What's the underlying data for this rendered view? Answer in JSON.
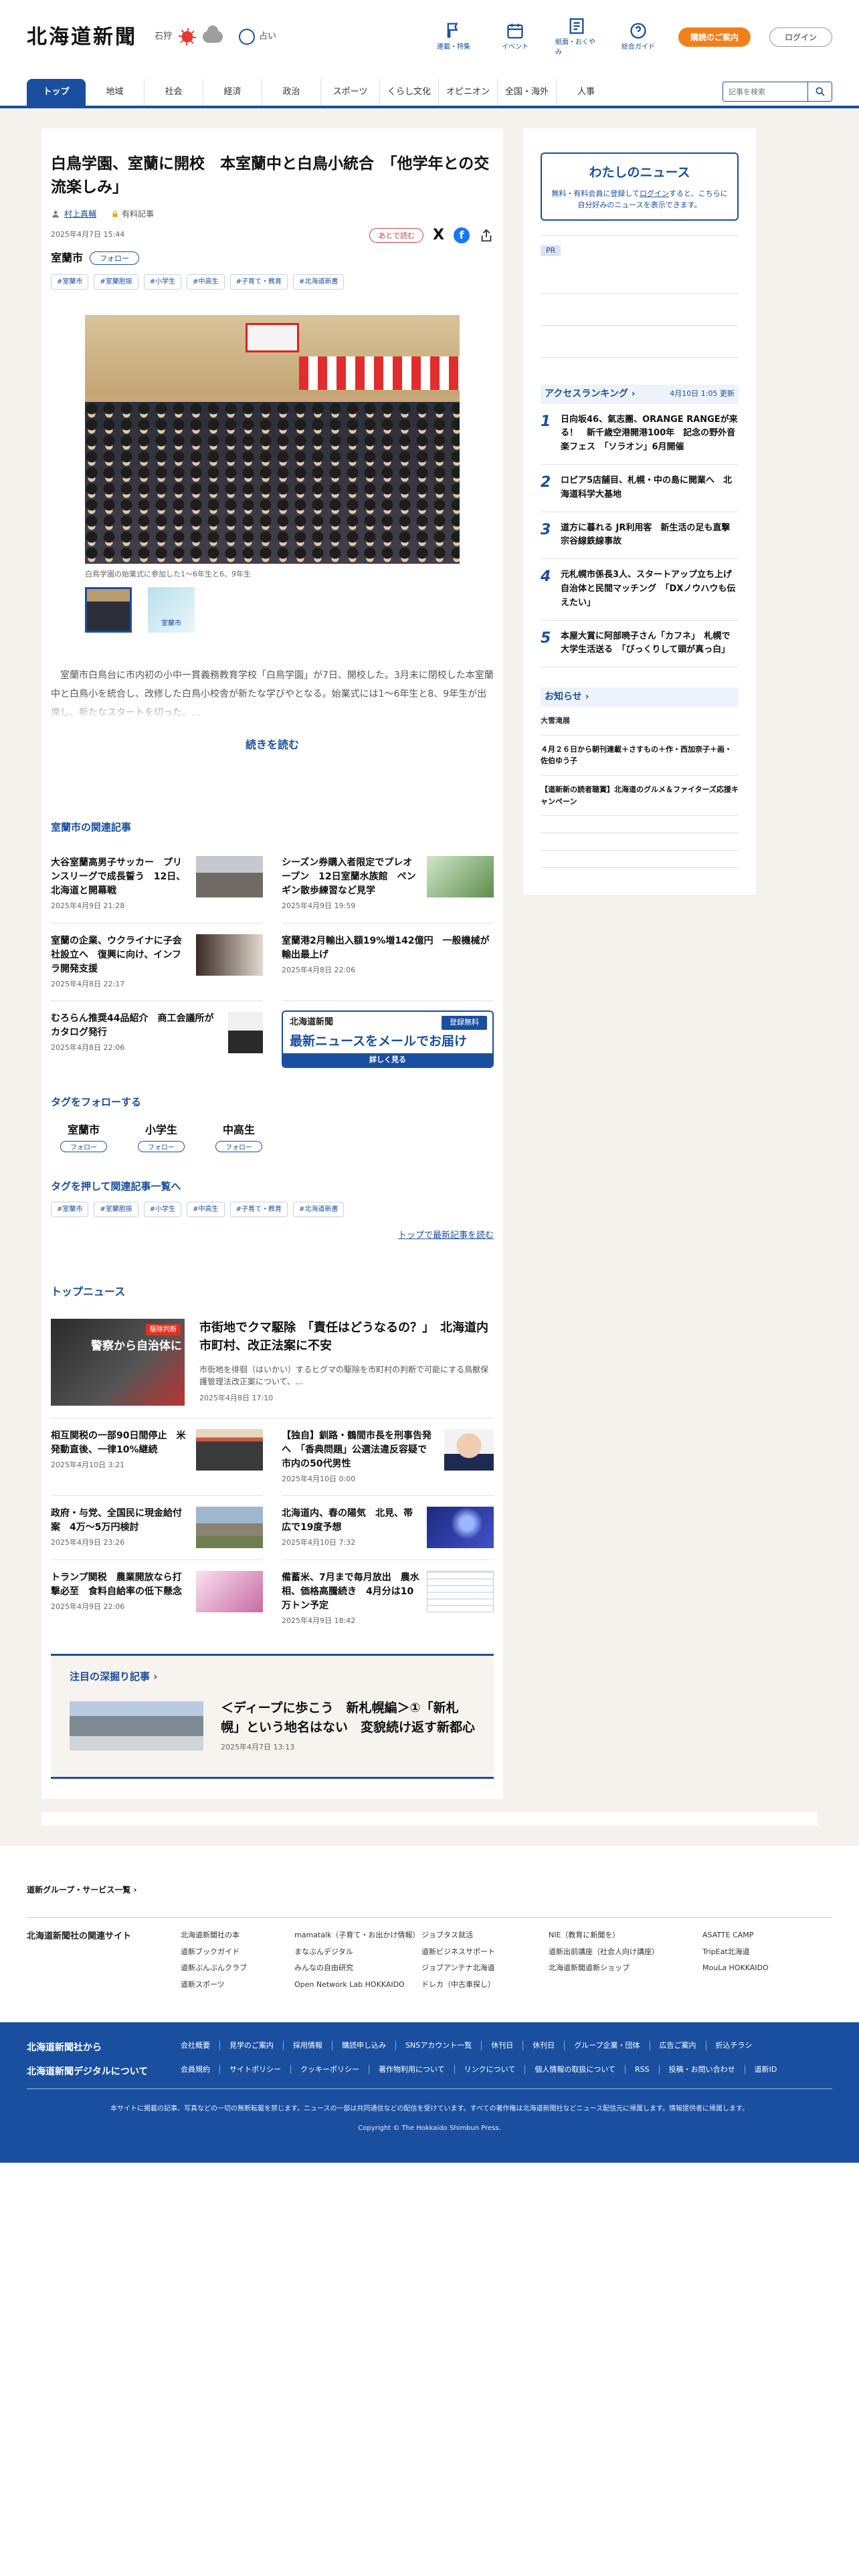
{
  "header": {
    "logo": "北海道新聞",
    "weather_location": "石狩",
    "fortune_label": "占い",
    "icon_links": [
      "連載・特集",
      "イベント",
      "紙面・おくやみ",
      "総合ガイド"
    ],
    "subscribe_label": "購読のご案内",
    "login_label": "ログイン"
  },
  "nav": {
    "items": [
      "トップ",
      "地域",
      "社会",
      "経済",
      "政治",
      "スポーツ",
      "くらし文化",
      "オピニオン",
      "全国・海外",
      "人事"
    ],
    "search_placeholder": "記事を検索"
  },
  "article": {
    "title": "白鳥学園、室蘭に開校　本室蘭中と白鳥小統合　「他学年との交流楽しみ」",
    "author": "村上真輔",
    "paid_label": "有料記事",
    "date": "2025年4月7日 15:44",
    "read_later": "あとで読む",
    "city": "室蘭市",
    "follow_label": "フォロー",
    "tags": [
      "#室蘭市",
      "#室蘭胆振",
      "#小学生",
      "#中高生",
      "#子育て・教育",
      "#北海道新書"
    ],
    "photo_caption": "白鳥学園の始業式に参加した1〜6年生と6、9年生",
    "thumb2_label": "室蘭市",
    "lead": "室蘭市白鳥台に市内初の小中一貫義務教育学校「白鳥学園」が7日、開校した。3月末に閉校した本室蘭中と白鳥小を統合し、改修した白鳥小校舎が新たな学びやとなる。始業式には1〜6年生と8、9年生が出席し、新たなスタートを切った。…",
    "read_more": "続きを読む"
  },
  "related": {
    "title": "室蘭市の関連記事",
    "items": [
      {
        "title": "大谷室蘭高男子サッカー　プリンスリーグで成長誓う　12日、北海道と開幕戦",
        "date": "2025年4月9日 21:28"
      },
      {
        "title": "シーズン券購入者限定でプレオープン　12日室蘭水族館　ペンギン散歩練習など見学",
        "date": "2025年4月9日 19:59"
      },
      {
        "title": "室蘭の企業、ウクライナに子会社設立へ　復興に向け、インフラ開発支援",
        "date": "2025年4月8日 22:17"
      },
      {
        "title": "室蘭港2月輸出入額19%増142億円　一般機械が輸出最上げ",
        "date": "2025年4月8日 22:06"
      },
      {
        "title": "むろらん推奨44品紹介　商工会議所がカタログ発行",
        "date": "2025年4月8日 22:06"
      }
    ],
    "mail_logo": "北海道新聞",
    "mail_free": "登録無料",
    "mail_head": "最新ニュースをメールでお届け",
    "mail_foot": "詳しく見る"
  },
  "follow_tags": {
    "title": "タグをフォローする",
    "items": [
      "室蘭市",
      "小学生",
      "中高生"
    ],
    "button": "フォロー"
  },
  "tag_press": {
    "title": "タグを押して関連記事一覧へ",
    "tags": [
      "#室蘭市",
      "#室蘭胆振",
      "#小学生",
      "#中高生",
      "#子育て・教育",
      "#北海道新書"
    ],
    "more": "トップで最新記事を読む"
  },
  "top_news": {
    "title": "トップニュース",
    "lead": {
      "title": "市街地でクマ駆除　「責任はどうなるの？」　北海道内市町村、改正法案に不安",
      "summary": "市街地を徘徊（はいかい）するヒグマの駆除を市町村の判断で可能にする鳥獣保護管理法改正案について、…",
      "date": "2025年4月8日 17:10",
      "img_tag": "駆除判断",
      "img_label": "警察から自治体に"
    },
    "items": [
      {
        "title": "相互関税の一部90日間停止　米発動直後、一律10%継続",
        "date": "2025年4月10日 3:21"
      },
      {
        "title": "【独自】釧路・鶴間市長を刑事告発へ　「香典問題」公選法違反容疑で　市内の50代男性",
        "date": "2025年4月10日 0:00"
      },
      {
        "title": "政府・与党、全国民に現金給付案　4万〜5万円検討",
        "date": "2025年4月9日 23:26"
      },
      {
        "title": "北海道内、春の陽気　北見、帯広で19度予想",
        "date": "2025年4月10日 7:32"
      },
      {
        "title": "トランプ関税　農業開放なら打撃必至　食料自給率の低下懸念",
        "date": "2025年4月9日 22:06"
      },
      {
        "title": "備蓄米、7月まで毎月放出　農水相、価格高騰続き　4月分は10万トン予定",
        "date": "2025年4月9日 18:42"
      }
    ]
  },
  "deep": {
    "title": "注目の深掘り記事",
    "item_title": "＜ディープに歩こう　新札幌編＞①「新札幌」という地名はない　変貌続け返す新都心",
    "item_date": "2025年4月7日 13:13"
  },
  "sidebar": {
    "my_news_title": "わたしのニュース",
    "my_news_text_1": "無料・有料会員に登録して",
    "my_news_login": "ログイン",
    "my_news_text_2": "すると、こちらに自分好みのニュースを表示できます。",
    "pr": "PR",
    "ranking_title": "アクセスランキング",
    "ranking_updated": "4月10日 1:05 更新",
    "ranking": [
      "日向坂46、氣志團、ORANGE RANGEが来る！　新千歳空港開港100年　記念の野外音楽フェス　「ソラオン」6月開催",
      "ロピア5店舗目、札幌・中の島に開業へ　北海道科学大基地",
      "道方に暮れる JR利用客　新生活の足も直撃　宗谷線鉄線事故",
      "元札幌市係長3人、スタートアップ立ち上げ　自治体と民間マッチング　「DXノウハウも伝えたい」",
      "本屋大賞に阿部暁子さん「カフネ」　札幌で大学生活送る　「びっくりして頭が真っ白」"
    ],
    "notice_title": "お知らせ",
    "notices": [
      "大雪滝展",
      "４月２６日から朝刊連載＋さすもの＋作・西加奈子＋画・佐伯ゆう子",
      "【道新新の読者聴賞】北海道のグルメ＆ファイターズ応援キャンペーン"
    ]
  },
  "footer": {
    "group_link": "道新グループ・サービス一覧",
    "related_label": "北海道新聞社の関連サイト",
    "sites": [
      "北海道新聞社の本",
      "mamatalk（子育て・お出かけ情報）",
      "ジョブタス就活",
      "NIE（教育に新聞を）",
      "ASATTE CAMP",
      "道新ブックガイド",
      "まなぶんデジタル",
      "道新ビジネスサポート",
      "道新出前講座（社会人向け講座）",
      "TripEat北海道",
      "道新ぶんぶんクラブ",
      "みんなの自由研究",
      "ジョブアンテナ北海道",
      "北海道新聞道新ショップ",
      "MouLa HOKKAIDO",
      "道新スポーツ",
      "Open Network Lab HOKKAIDO",
      "ドレカ（中古車探し）",
      "",
      ""
    ],
    "from_label": "北海道新聞社から",
    "from_links": [
      "会社概要",
      "見学のご案内",
      "採用情報",
      "購読申し込み",
      "SNSアカウント一覧",
      "休刊日",
      "休刊日",
      "グループ企業・団体",
      "広告ご案内",
      "折込チラシ"
    ],
    "digital_label": "北海道新聞デジタルについて",
    "digital_links": [
      "会員規約",
      "サイトポリシー",
      "クッキーポリシー",
      "著作物利用について",
      "リンクについて",
      "個人情報の取扱について",
      "RSS",
      "投稿・お問い合わせ",
      "道新ID"
    ],
    "note": "本サイトに掲載の記事、写真などの一切の無断転載を禁じます。ニュースの一部は共同通信などの配信を受けています。すべての著作権は北海道新聞社などニュース配信元に帰属します。情報提供者に帰属します。",
    "copyright": "Copyright © The Hokkaido Shimbun Press."
  }
}
